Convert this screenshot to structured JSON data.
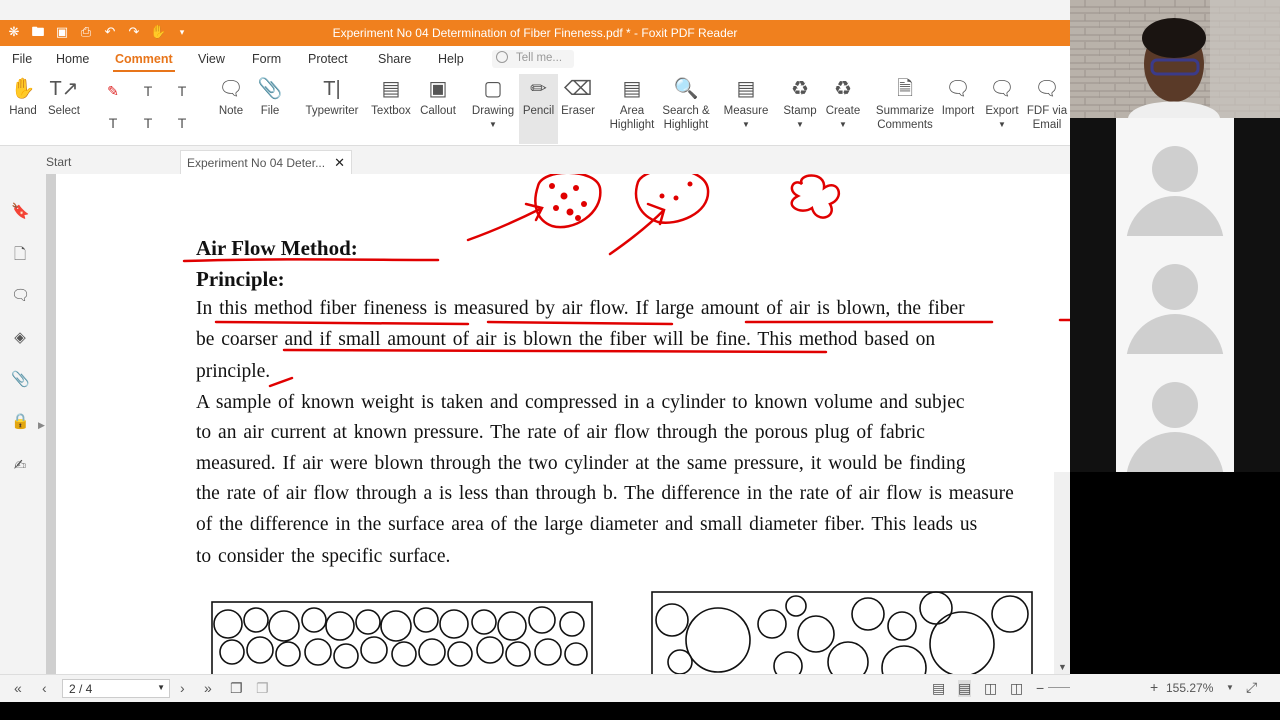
{
  "window": {
    "title": "Experiment No 04 Determination of Fiber Fineness.pdf * - Foxit PDF Reader"
  },
  "menu": [
    "File",
    "Home",
    "Comment",
    "View",
    "Form",
    "Protect",
    "Share",
    "Help"
  ],
  "active_menu": "Comment",
  "tell_me_placeholder": "Tell me...",
  "ribbon": {
    "hand": "Hand",
    "select": "Select",
    "note": "Note",
    "file": "File",
    "typewriter": "Typewriter",
    "textbox": "Textbox",
    "callout": "Callout",
    "drawing": "Drawing",
    "pencil": "Pencil",
    "eraser": "Eraser",
    "area_highlight": [
      "Area",
      "Highlight"
    ],
    "search_highlight": [
      "Search &",
      "Highlight"
    ],
    "measure": "Measure",
    "stamp": "Stamp",
    "create": "Create",
    "summarize": [
      "Summarize",
      "Comments"
    ],
    "import": "Import",
    "export": "Export",
    "fdf_email": [
      "FDF via",
      "Email"
    ]
  },
  "tabs": {
    "start": "Start",
    "doc": "Experiment No 04 Deter..."
  },
  "document": {
    "heading": "Air Flow Method:",
    "principle": "Principle:",
    "lines": [
      "In this method fiber fineness is measured by air flow. If large amount of air is blown, the fiber",
      "be coarser and if small amount of air is blown the fiber will be fine. This method based on",
      "principle.",
      "A sample of known weight is taken and compressed in a cylinder to known volume and subjec",
      "to an air current at known pressure. The rate of air flow through the porous plug of fabric",
      "measured. If air were blown through the two cylinder at the same pressure, it would be finding",
      "the rate of air flow through a is less than through b. The difference in the rate of air flow is measure",
      "of the difference in the surface area of the large diameter and small diameter fiber. This leads us",
      "to consider the specific surface."
    ]
  },
  "status": {
    "page": "2 / 4",
    "zoom": "155.27%",
    "zoom_level": 0.62
  },
  "colors": {
    "accent": "#f0801e",
    "ink": "#e00000"
  }
}
